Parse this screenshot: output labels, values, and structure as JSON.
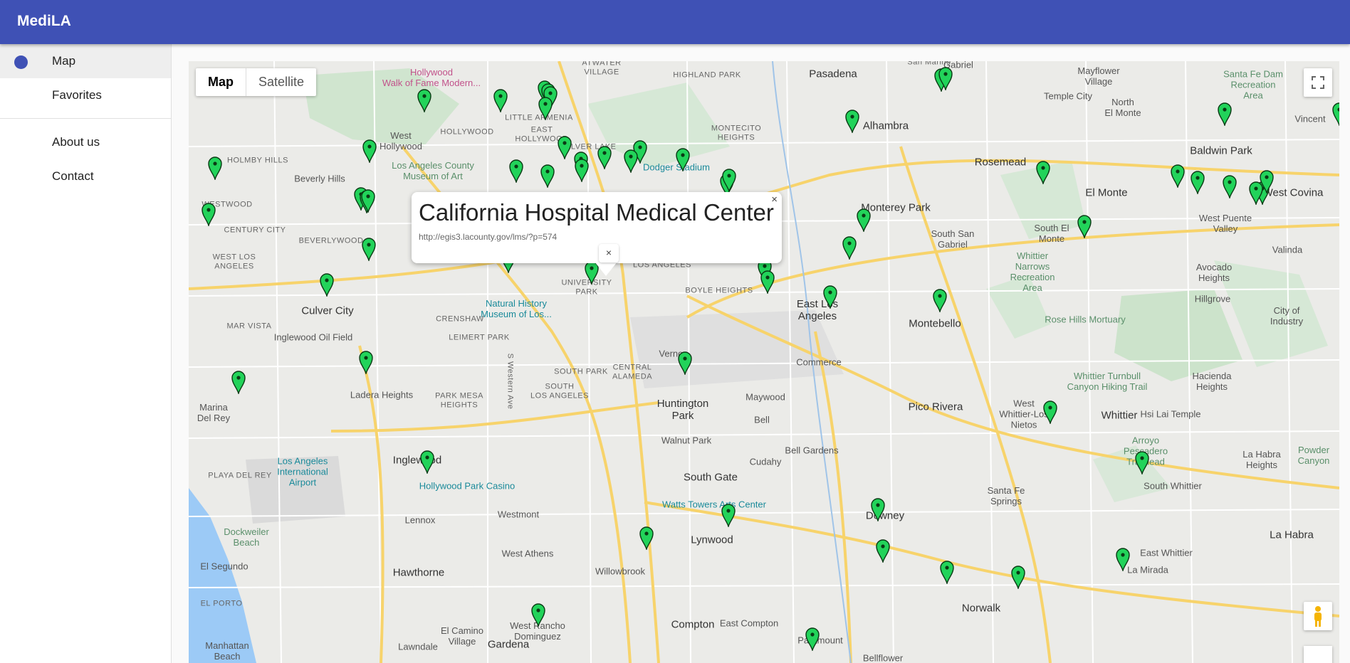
{
  "app": {
    "title": "MediLA"
  },
  "sidebar": {
    "items": [
      {
        "label": "Map"
      },
      {
        "label": "Favorites"
      },
      {
        "label": "About us"
      },
      {
        "label": "Contact"
      }
    ]
  },
  "map": {
    "type_buttons": {
      "map": "Map",
      "satellite": "Satellite"
    },
    "popup": {
      "title": "California Hospital Medical Center",
      "url": "http://egis3.lacounty.gov/lms/?p=574",
      "close": "×"
    },
    "labels": {
      "hollywood_walk": "Hollywood\nWalk of Fame Modern...",
      "pasadena": "Pasadena",
      "gabriel": "Gabriel",
      "mayflower": "Mayflower\nVillage",
      "santa_fe_dam": "Santa Fe Dam\nRecreation\nArea",
      "alhambra": "Alhambra",
      "temple_city": "Temple City",
      "north_el_monte": "North\nEl Monte",
      "vincent": "Vincent",
      "baldwin_park": "Baldwin Park",
      "west_hollywood": "West\nHollywood",
      "hollywood": "HOLLYWOOD",
      "little_armenia": "LITTLE ARMENIA",
      "east_hollywood": "EAST\nHOLLYWOOD",
      "silver_lake": "SILVER LAKE",
      "dodger": "Dodger Stadium",
      "montecito": "MONTECITO\nHEIGHTS",
      "rosemead": "Rosemead",
      "holmby": "HOLMBY HILLS",
      "beverly_hills": "Beverly Hills",
      "lacma": "Los Angeles County\nMuseum of Art",
      "westwood": "WESTWOOD",
      "el_monte": "El Monte",
      "west_covina": "West Covina",
      "monterey_park": "Monterey Park",
      "century_city": "CENTURY CITY",
      "beverlywood": "BEVERLYWOOD",
      "south_san_gabriel": "South San\nGabriel",
      "south_el_monte": "South El\nMonte",
      "west_puente": "West Puente\nValley",
      "valinda": "Valinda",
      "west_la": "WEST LOS\nANGELES",
      "whittier_narrows": "Whittier\nNarrows\nRecreation\nArea",
      "avocado": "Avocado\nHeights",
      "culver_city": "Culver City",
      "boyle": "BOYLE HEIGHTS",
      "east_la": "East Los\nAngeles",
      "montebello": "Montebello",
      "city_industry": "City of\nIndustry",
      "hillgrove": "Hillgrove",
      "mar_vista": "MAR VISTA",
      "nhm": "Natural History\nMuseum of Los...",
      "university_park": "UNIVERSITY\nPARK",
      "crenshaw": "CRENSHAW",
      "rose_hills": "Rose Hills Mortuary",
      "inglewood_oil": "Inglewood Oil Field",
      "leimert": "LEIMERT PARK",
      "vernon": "Vernon",
      "commerce": "Commerce",
      "hacienda": "Hacienda\nHeights",
      "whittier_turnbull": "Whittier Turnbull\nCanyon Hiking Trail",
      "south_park": "SOUTH PARK",
      "central_alameda": "CENTRAL\nALAMEDA",
      "marina": "Marina\nDel Rey",
      "ladera": "Ladera Heights",
      "park_mesa": "PARK MESA\nHEIGHTS",
      "south_la": "SOUTH\nLOS ANGELES",
      "huntington_park": "Huntington\nPark",
      "maywood": "Maywood",
      "pico_rivera": "Pico Rivera",
      "west_whittier": "West\nWhittier-Los\nNietos",
      "whittier": "Whittier",
      "hsi_lai": "Hsi Lai Temple",
      "bell": "Bell",
      "walnut_park": "Walnut Park",
      "bell_gardens": "Bell Gardens",
      "arroyo": "Arroyo\nPescadero\nTrailhead",
      "la_habra_heights": "La Habra\nHeights",
      "powder_canyon": "Powder\nCanyon",
      "lax": "Los Angeles\nInternational\nAirport",
      "playa_del_rey": "PLAYA DEL REY",
      "inglewood": "Inglewood",
      "south_gate": "South Gate",
      "cudahy": "Cudahy",
      "hollywood_park": "Hollywood Park Casino",
      "santa_fe_springs": "Santa Fe\nSprings",
      "south_whittier": "South Whittier",
      "watts": "Watts Towers Arts Center",
      "westmont": "Westmont",
      "lennox": "Lennox",
      "downey": "Downey",
      "la_habra": "La Habra",
      "dockweiler": "Dockweiler\nBeach",
      "lynwood": "Lynwood",
      "el_segundo": "El Segundo",
      "west_athens": "West Athens",
      "east_whittier": "East Whittier",
      "willowbrook": "Willowbrook",
      "hawthorne": "Hawthorne",
      "la_mirada": "La Mirada",
      "el_porto": "EL PORTO",
      "norwalk": "Norwalk",
      "compton": "Compton",
      "east_compton": "East Compton",
      "west_rancho": "West Rancho\nDominguez",
      "el_camino": "El Camino\nVillage",
      "paramount": "Paramount",
      "gardena": "Gardena",
      "manhattan": "Manhattan\nBeach",
      "lawndale": "Lawndale",
      "bellflower": "Bellflower",
      "atwater": "ATWATER\nVILLAGE",
      "highland": "HIGHLAND PARK",
      "san_marino": "San Marino",
      "s_western": "S Western Ave",
      "los_angeles": "LOS ANGELES"
    }
  }
}
